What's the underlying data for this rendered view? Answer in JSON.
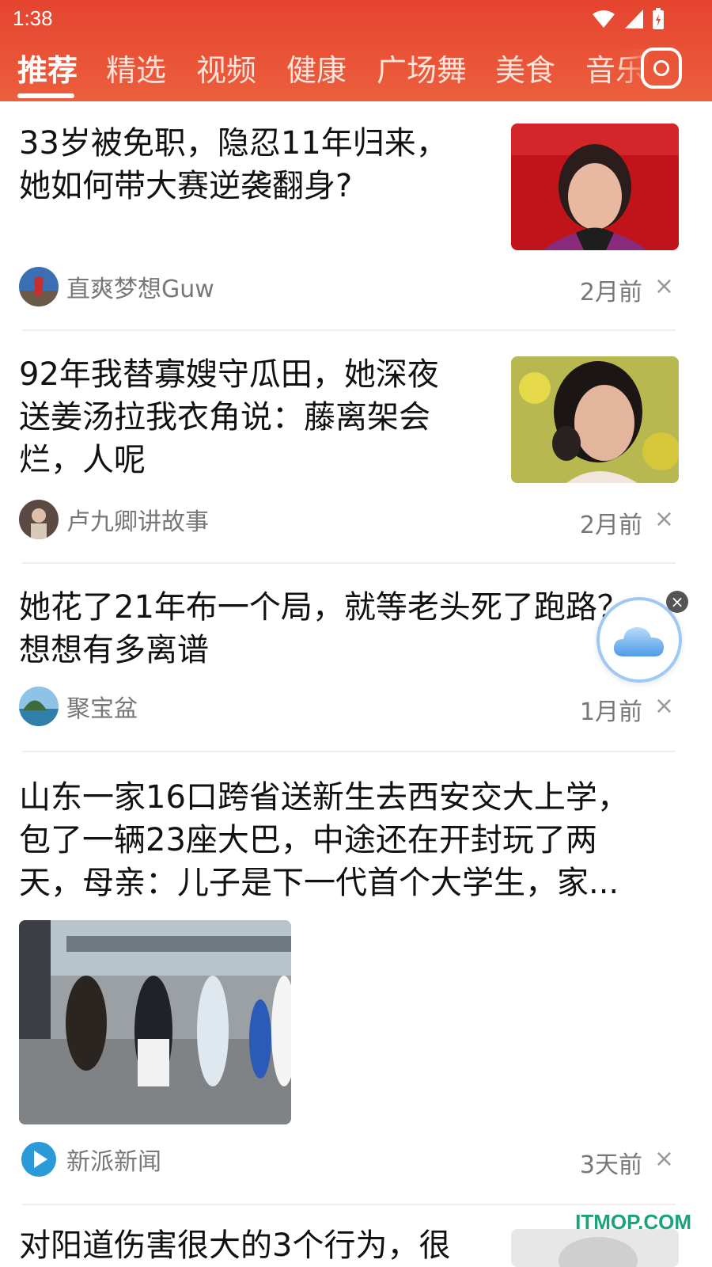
{
  "status_bar": {
    "time": "1:38"
  },
  "tabs": [
    {
      "label": "推荐"
    },
    {
      "label": "精选"
    },
    {
      "label": "视频"
    },
    {
      "label": "健康"
    },
    {
      "label": "广场舞"
    },
    {
      "label": "美食"
    },
    {
      "label": "音乐"
    }
  ],
  "articles": [
    {
      "title_lines": [
        "33岁被免职，隐忍11年归来，",
        "她如何带大赛逆袭翻身?"
      ],
      "author": "直爽梦想Guw",
      "time": "2月前",
      "close": "×"
    },
    {
      "title_lines": [
        "92年我替寡嫂守瓜田，她深夜",
        "送姜汤拉我衣角说：藤离架会",
        "烂，人呢"
      ],
      "author": "卢九卿讲故事",
      "time": "2月前",
      "close": "×"
    },
    {
      "title_lines": [
        "她花了21年布一个局，就等老头死了跑路？",
        "想想有多离谱"
      ],
      "author": "聚宝盆",
      "time": "1月前",
      "close": "×"
    },
    {
      "title_lines": [
        "山东一家16口跨省送新生去西安交大上学，",
        "包了一辆23座大巴，中途还在开封玩了两",
        "天，母亲：儿子是下一代首个大学生，家..."
      ],
      "author": "新派新闻",
      "time": "3天前",
      "close": "×"
    },
    {
      "title_lines": [
        "对阳道伤害很大的3个行为，很"
      ]
    }
  ],
  "float_widget": {
    "close": "×"
  },
  "watermark": "ITMOP.COM",
  "colors": {
    "header": "#e5442f",
    "accent": "#1aa37a"
  }
}
